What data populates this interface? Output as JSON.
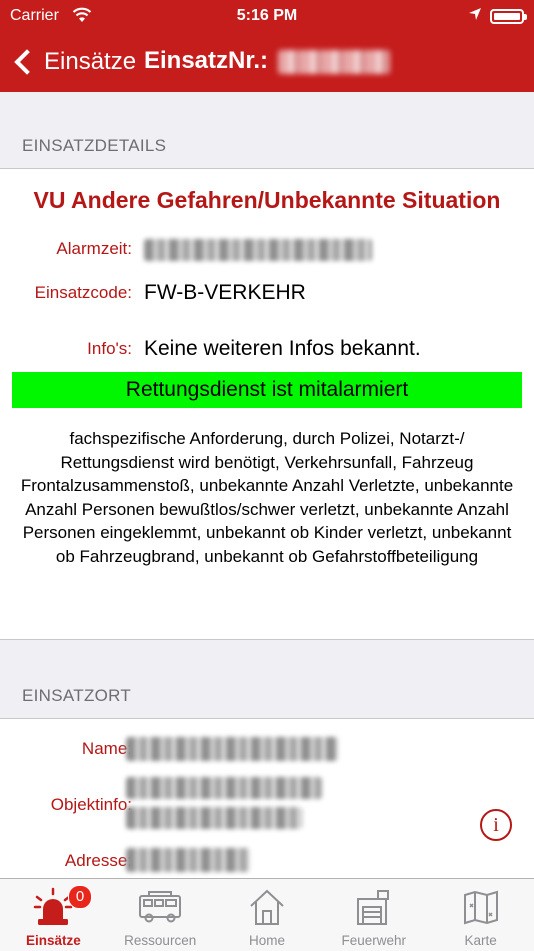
{
  "status_bar": {
    "carrier": "Carrier",
    "time": "5:16 PM"
  },
  "nav": {
    "back_label": "Einsätze",
    "title": "EinsatzNr.:"
  },
  "details": {
    "section_title": "EINSATZDETAILS",
    "incident_title": "VU Andere Gefahren/Unbekannte Situation",
    "alarm_label": "Alarmzeit:",
    "code_label": "Einsatzcode:",
    "code_value": "FW-B-VERKEHR",
    "info_label": "Info's:",
    "info_value": "Keine weiteren Infos bekannt.",
    "rescue_banner": "Rettungsdienst ist mitalarmiert",
    "description": "fachspezifische Anforderung, durch Polizei, Notarzt-/ Rettungsdienst wird benötigt, Verkehrsunfall, Fahrzeug Frontalzusammenstoß, unbekannte Anzahl Verletzte, unbekannte Anzahl Personen bewußtlos/schwer verletzt, unbekannte Anzahl Personen eingeklemmt, unbekannt ob Kinder verletzt, unbekannt ob Fahrzeugbrand, unbekannt ob Gefahrstoffbeteiligung"
  },
  "location": {
    "section_title": "EINSATZORT",
    "name_label": "Name:",
    "object_label": "Objektinfo:",
    "address_label": "Adresse:",
    "info_button": "i"
  },
  "tabs": [
    {
      "label": "Einsätze",
      "icon": "siren-icon",
      "active": true,
      "badge": "0"
    },
    {
      "label": "Ressourcen",
      "icon": "vehicle-icon"
    },
    {
      "label": "Home",
      "icon": "house-icon"
    },
    {
      "label": "Feuerwehr",
      "icon": "firestation-icon"
    },
    {
      "label": "Karte",
      "icon": "map-icon"
    }
  ],
  "colors": {
    "brand_red": "#c51c1c",
    "label_red": "#b51717",
    "banner_green": "#00f700",
    "badge_red": "#e8261c"
  }
}
